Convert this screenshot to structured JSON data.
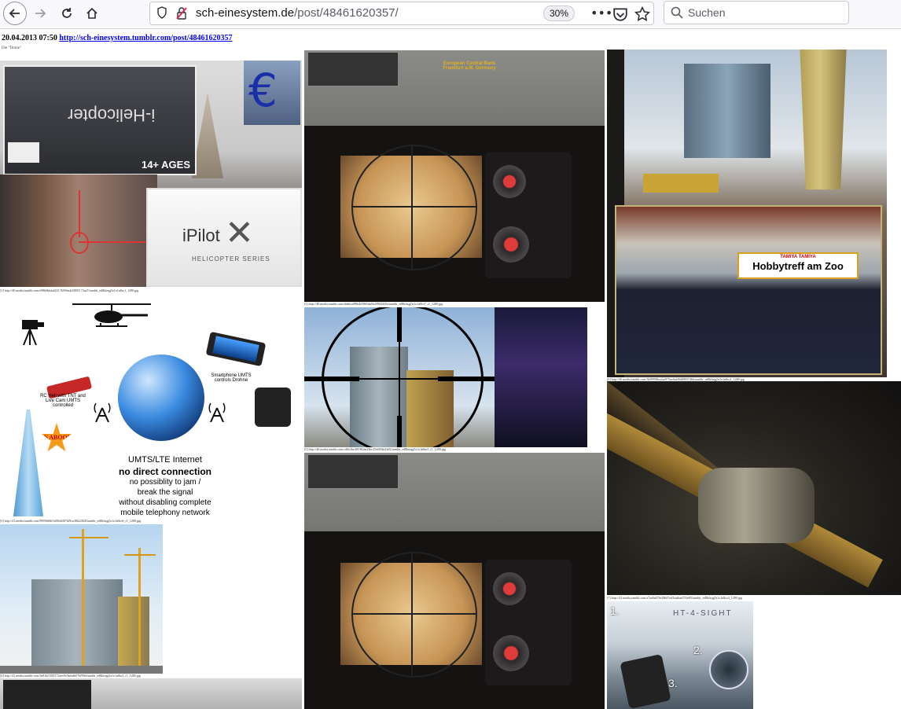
{
  "browser": {
    "url_domain": "sch-einesystem.de",
    "url_path": "/post/48461620357/",
    "zoom": "30%",
    "search_placeholder": "Suchen"
  },
  "post": {
    "date": "20.04.2013 07:50",
    "link": "http://sch-einesystem.tumblr.com/post/48461620357",
    "subtitle": "Die \"Drone\"",
    "captions": [
      "[1] http://40.media.tumblr.com/e98b0bbda6f25 7b99da4e58055 72aa7/tumblr_ed8kfzqg5z1o1n8ro1_1280.jpg",
      "[2] http://40.media.tumblr.com/dda6ca98bf4e58b5da6fa589f2d45e/tumblr_ed8kfzqg5z1o1n8ro7_r1_1280.jpg",
      "[3] http://41.media.tumblr.com/89938d6b7a08fd4f07bf9ca38b22828/tumblr_ed8kfzqg5z1o1n8ro6_r1_1280.jpg",
      "[4] http://41.media.tumblr.com/3e81bf7485172aee9c9aebdb07bf99d/tumblr_ed8kfzqg5z1o1n8ro3_r1_1280.jpg",
      "[5] http://40.media.tumblr.com/cd0e2be491982ea23bc25e693be1b02/tumblr_ed8kfzqg5z1o1n8ro5_r1_1280.jpg",
      "[6] http://36.media.tumblr.com/3bf999f8ea2aa975ae6a4f8dd98374bb/tumblr_ed8kfzqg5z1o1n8ro1_1280.jpg",
      "[7] http://41.media.tumblr.com/a7ae6a479e28b97ed3aaabad753e85/tumblr_ed8kfzqg5z1o1n8ro4_1280.jpg"
    ]
  },
  "images": {
    "helicopter_box": {
      "label": "i-Helicopter",
      "age": "14+ AGES"
    },
    "ipilot_box": {
      "brand": "iPilot",
      "series": "HELICOPTER SERIES"
    },
    "diagram": {
      "heli_label": "RC Heli with TNT and Live Cam UMTS controlled",
      "phone_label": "Smartphone UMTS controls Drohne",
      "kaboom": "KABOOM",
      "line1": "UMTS/LTE Internet",
      "line2": "no direct connection",
      "line3": "no possiblity to jam /",
      "line4": "break the signal",
      "line5": "without disabling complete",
      "line6": "mobile telephony network"
    },
    "ecb_label": "European Central Bank Frankfurt a.M. Germany",
    "shop_sign": "Hobbytreff am Zoo",
    "tamiya": "TAMIYA TAMIYA",
    "ht4sight": "HT-4-SIGHT",
    "steps": [
      "1.",
      "2.",
      "3."
    ]
  }
}
